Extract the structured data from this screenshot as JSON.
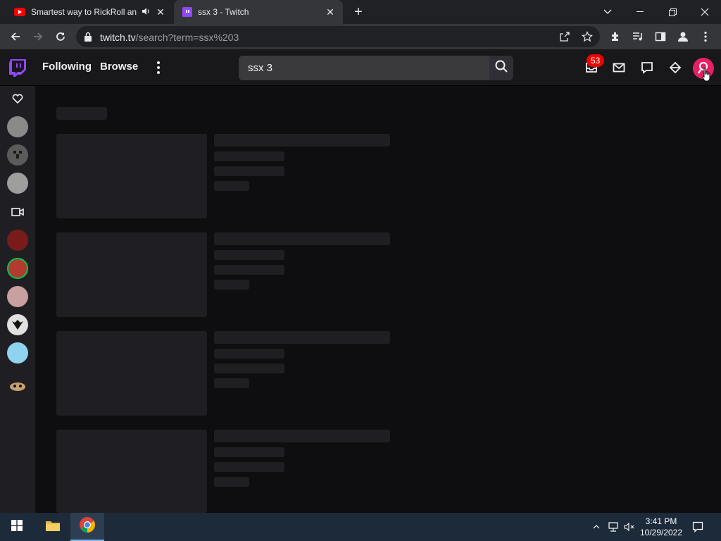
{
  "browser": {
    "tabs": [
      {
        "title": "Smartest way to RickRoll anyone",
        "favicon": "youtube-icon",
        "audio": true
      },
      {
        "title": "ssx 3 - Twitch",
        "favicon": "twitch-icon",
        "active": true
      }
    ],
    "url_host": "twitch.tv",
    "url_path": "/search?term=ssx%203"
  },
  "twitch": {
    "nav": {
      "following": "Following",
      "browse": "Browse"
    },
    "search": {
      "value": "ssx 3"
    },
    "notifications_badge": "53",
    "brand_color": "#9146ff"
  },
  "sidebar": {
    "followed_avatars": [
      "avatar-1",
      "avatar-2",
      "avatar-3"
    ],
    "recommended_avatars": [
      "avatar-4",
      "avatar-5",
      "avatar-6",
      "avatar-7",
      "avatar-8",
      "avatar-9"
    ]
  },
  "main": {
    "state": "loading",
    "placeholder_rows": 4
  },
  "taskbar": {
    "time": "3:41 PM",
    "date": "10/29/2022"
  }
}
